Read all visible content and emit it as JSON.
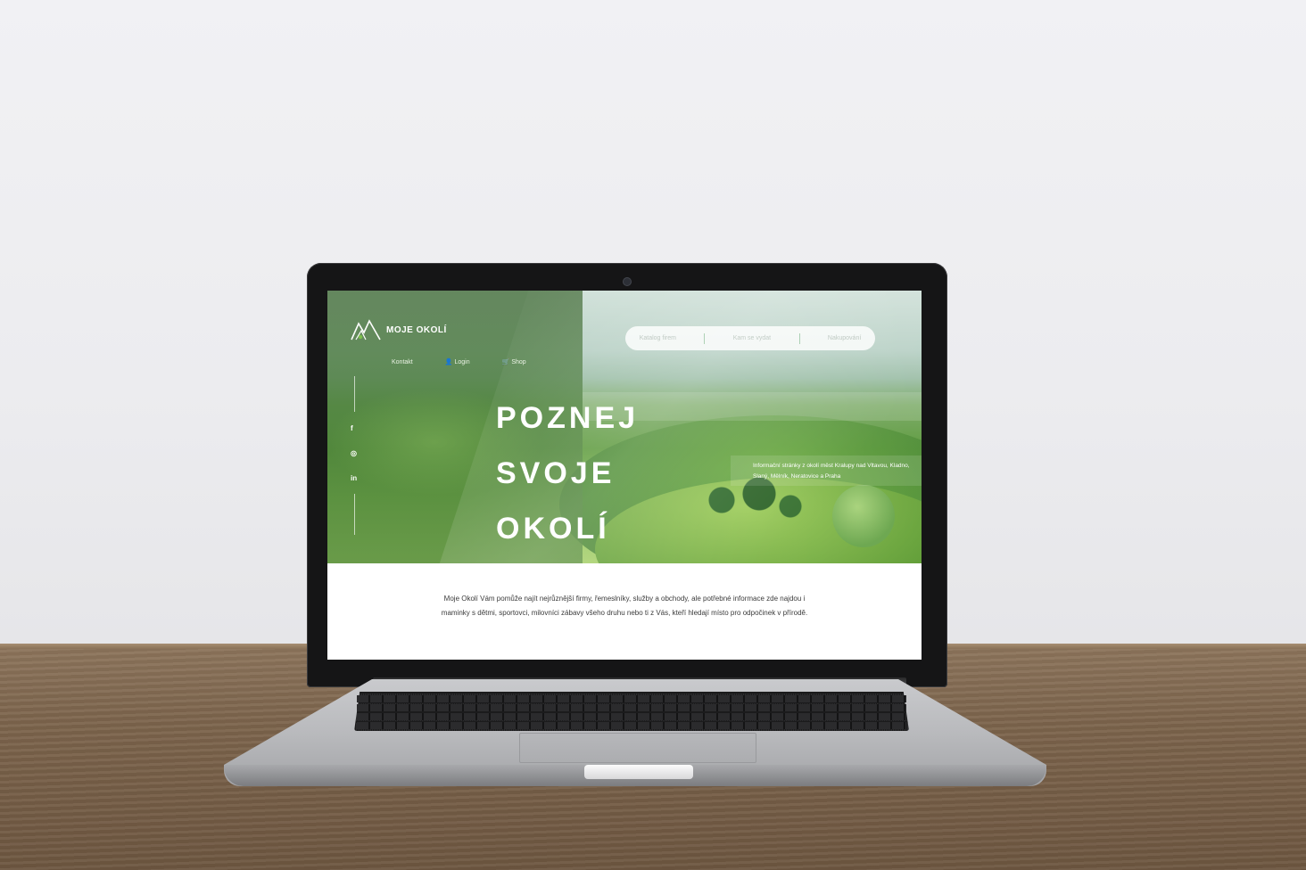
{
  "site": {
    "logo_text": "MOJE OKOLÍ",
    "accent_color": "#5c9a3c"
  },
  "nav": {
    "items": [
      {
        "label": "Kontakt",
        "icon": ""
      },
      {
        "label": "Login",
        "icon": "user-icon"
      },
      {
        "label": "Shop",
        "icon": "basket-icon"
      }
    ]
  },
  "search_bar": {
    "items": [
      "Katalog firem",
      "Kam se vydat",
      "Nakupování"
    ]
  },
  "social": {
    "items": [
      {
        "glyph": "f",
        "icon": "facebook-icon"
      },
      {
        "glyph": "◎",
        "icon": "instagram-icon"
      },
      {
        "glyph": "in",
        "icon": "linkedin-icon"
      }
    ]
  },
  "hero": {
    "headline": [
      "POZNEJ",
      "SVOJE",
      "OKOLÍ"
    ],
    "info": "Informační stránky z okolí měst Kralupy nad Vltavou, Kladno, Slaný, Mělník, Neratovice a Praha"
  },
  "intro": {
    "text": "Moje Okolí Vám pomůže najít nejrůznější firmy, řemeslníky, služby a obchody, ale potřebné informace zde najdou i maminky s dětmi, sportovci, milovníci zábavy všeho druhu nebo ti z Vás, kteří hledají místo pro odpočinek v přírodě."
  }
}
